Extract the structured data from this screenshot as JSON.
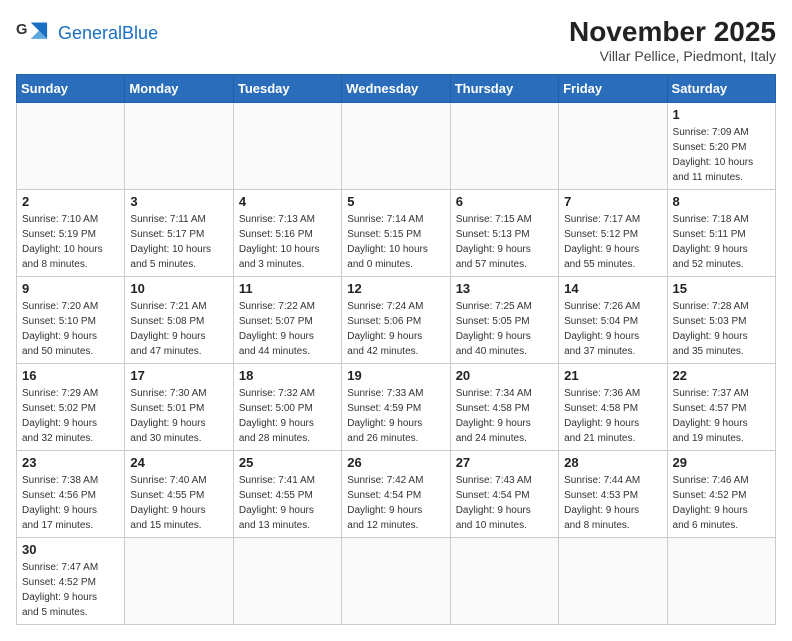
{
  "header": {
    "logo_general": "General",
    "logo_blue": "Blue",
    "title": "November 2025",
    "subtitle": "Villar Pellice, Piedmont, Italy"
  },
  "weekdays": [
    "Sunday",
    "Monday",
    "Tuesday",
    "Wednesday",
    "Thursday",
    "Friday",
    "Saturday"
  ],
  "weeks": [
    [
      {
        "day": "",
        "info": ""
      },
      {
        "day": "",
        "info": ""
      },
      {
        "day": "",
        "info": ""
      },
      {
        "day": "",
        "info": ""
      },
      {
        "day": "",
        "info": ""
      },
      {
        "day": "",
        "info": ""
      },
      {
        "day": "1",
        "info": "Sunrise: 7:09 AM\nSunset: 5:20 PM\nDaylight: 10 hours\nand 11 minutes."
      }
    ],
    [
      {
        "day": "2",
        "info": "Sunrise: 7:10 AM\nSunset: 5:19 PM\nDaylight: 10 hours\nand 8 minutes."
      },
      {
        "day": "3",
        "info": "Sunrise: 7:11 AM\nSunset: 5:17 PM\nDaylight: 10 hours\nand 5 minutes."
      },
      {
        "day": "4",
        "info": "Sunrise: 7:13 AM\nSunset: 5:16 PM\nDaylight: 10 hours\nand 3 minutes."
      },
      {
        "day": "5",
        "info": "Sunrise: 7:14 AM\nSunset: 5:15 PM\nDaylight: 10 hours\nand 0 minutes."
      },
      {
        "day": "6",
        "info": "Sunrise: 7:15 AM\nSunset: 5:13 PM\nDaylight: 9 hours\nand 57 minutes."
      },
      {
        "day": "7",
        "info": "Sunrise: 7:17 AM\nSunset: 5:12 PM\nDaylight: 9 hours\nand 55 minutes."
      },
      {
        "day": "8",
        "info": "Sunrise: 7:18 AM\nSunset: 5:11 PM\nDaylight: 9 hours\nand 52 minutes."
      }
    ],
    [
      {
        "day": "9",
        "info": "Sunrise: 7:20 AM\nSunset: 5:10 PM\nDaylight: 9 hours\nand 50 minutes."
      },
      {
        "day": "10",
        "info": "Sunrise: 7:21 AM\nSunset: 5:08 PM\nDaylight: 9 hours\nand 47 minutes."
      },
      {
        "day": "11",
        "info": "Sunrise: 7:22 AM\nSunset: 5:07 PM\nDaylight: 9 hours\nand 44 minutes."
      },
      {
        "day": "12",
        "info": "Sunrise: 7:24 AM\nSunset: 5:06 PM\nDaylight: 9 hours\nand 42 minutes."
      },
      {
        "day": "13",
        "info": "Sunrise: 7:25 AM\nSunset: 5:05 PM\nDaylight: 9 hours\nand 40 minutes."
      },
      {
        "day": "14",
        "info": "Sunrise: 7:26 AM\nSunset: 5:04 PM\nDaylight: 9 hours\nand 37 minutes."
      },
      {
        "day": "15",
        "info": "Sunrise: 7:28 AM\nSunset: 5:03 PM\nDaylight: 9 hours\nand 35 minutes."
      }
    ],
    [
      {
        "day": "16",
        "info": "Sunrise: 7:29 AM\nSunset: 5:02 PM\nDaylight: 9 hours\nand 32 minutes."
      },
      {
        "day": "17",
        "info": "Sunrise: 7:30 AM\nSunset: 5:01 PM\nDaylight: 9 hours\nand 30 minutes."
      },
      {
        "day": "18",
        "info": "Sunrise: 7:32 AM\nSunset: 5:00 PM\nDaylight: 9 hours\nand 28 minutes."
      },
      {
        "day": "19",
        "info": "Sunrise: 7:33 AM\nSunset: 4:59 PM\nDaylight: 9 hours\nand 26 minutes."
      },
      {
        "day": "20",
        "info": "Sunrise: 7:34 AM\nSunset: 4:58 PM\nDaylight: 9 hours\nand 24 minutes."
      },
      {
        "day": "21",
        "info": "Sunrise: 7:36 AM\nSunset: 4:58 PM\nDaylight: 9 hours\nand 21 minutes."
      },
      {
        "day": "22",
        "info": "Sunrise: 7:37 AM\nSunset: 4:57 PM\nDaylight: 9 hours\nand 19 minutes."
      }
    ],
    [
      {
        "day": "23",
        "info": "Sunrise: 7:38 AM\nSunset: 4:56 PM\nDaylight: 9 hours\nand 17 minutes."
      },
      {
        "day": "24",
        "info": "Sunrise: 7:40 AM\nSunset: 4:55 PM\nDaylight: 9 hours\nand 15 minutes."
      },
      {
        "day": "25",
        "info": "Sunrise: 7:41 AM\nSunset: 4:55 PM\nDaylight: 9 hours\nand 13 minutes."
      },
      {
        "day": "26",
        "info": "Sunrise: 7:42 AM\nSunset: 4:54 PM\nDaylight: 9 hours\nand 12 minutes."
      },
      {
        "day": "27",
        "info": "Sunrise: 7:43 AM\nSunset: 4:54 PM\nDaylight: 9 hours\nand 10 minutes."
      },
      {
        "day": "28",
        "info": "Sunrise: 7:44 AM\nSunset: 4:53 PM\nDaylight: 9 hours\nand 8 minutes."
      },
      {
        "day": "29",
        "info": "Sunrise: 7:46 AM\nSunset: 4:52 PM\nDaylight: 9 hours\nand 6 minutes."
      }
    ],
    [
      {
        "day": "30",
        "info": "Sunrise: 7:47 AM\nSunset: 4:52 PM\nDaylight: 9 hours\nand 5 minutes."
      },
      {
        "day": "",
        "info": ""
      },
      {
        "day": "",
        "info": ""
      },
      {
        "day": "",
        "info": ""
      },
      {
        "day": "",
        "info": ""
      },
      {
        "day": "",
        "info": ""
      },
      {
        "day": "",
        "info": ""
      }
    ]
  ]
}
